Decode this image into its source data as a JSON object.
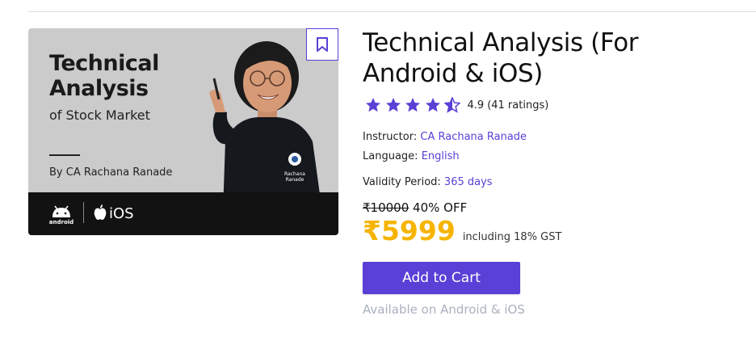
{
  "thumbnail": {
    "title_line1": "Technical",
    "title_line2": "Analysis",
    "subtitle": "of Stock Market",
    "byline": "By CA Rachana Ranade",
    "android_label": "android",
    "ios_label": "iOS",
    "shirt_logo_line1": "Rachana",
    "shirt_logo_line2": "Ranade"
  },
  "course": {
    "title": "Technical Analysis (For Android & iOS)",
    "rating_value": "4.9",
    "rating_count": "(41 ratings)",
    "rating_stars": 4.5,
    "instructor_label": "Instructor:",
    "instructor_value": "CA Rachana Ranade",
    "language_label": "Language:",
    "language_value": "English",
    "validity_label": "Validity Period:",
    "validity_value": "365 days",
    "original_price": "₹10000",
    "discount": "40% OFF",
    "final_price": "₹5999",
    "gst_note": "including 18% GST",
    "cart_button": "Add to Cart",
    "availability": "Available on Android & iOS"
  },
  "icons": {
    "bookmark": "bookmark-icon",
    "star": "star-icon",
    "android": "android-icon",
    "apple": "apple-icon"
  },
  "colors": {
    "accent": "#5b3fd6",
    "price": "#f6b400",
    "star": "#5b3fd6",
    "availability": "#aab0bf"
  }
}
